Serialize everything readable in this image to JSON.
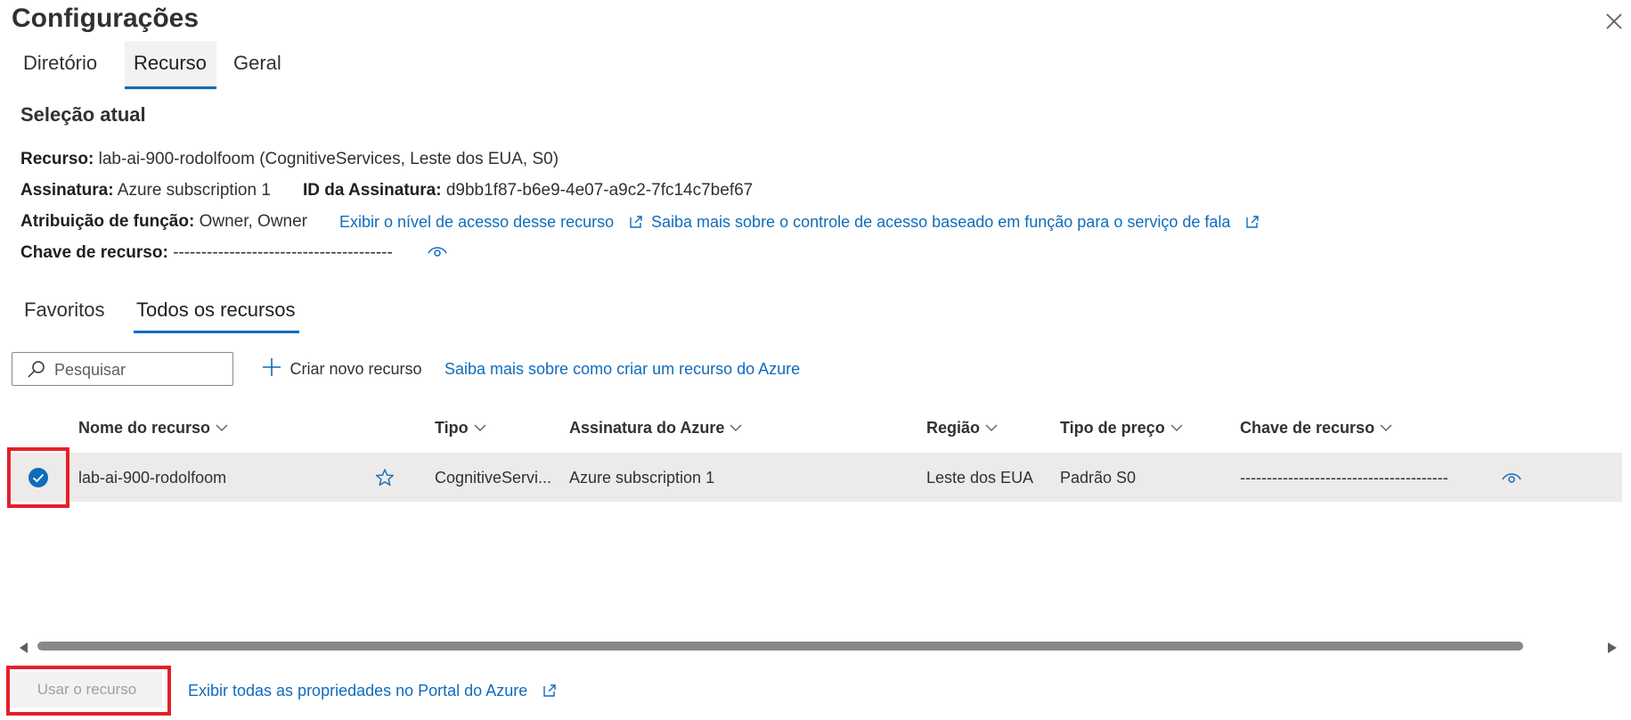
{
  "dialog": {
    "title": "Configurações",
    "close_icon": "close-icon"
  },
  "top_tabs": [
    {
      "label": "Diretório",
      "active": false
    },
    {
      "label": "Recurso",
      "active": true
    },
    {
      "label": "Geral",
      "active": false
    }
  ],
  "current_selection": {
    "title": "Seleção atual",
    "resource_label": "Recurso:",
    "resource_value": "lab-ai-900-rodolfoom (CognitiveServices, Leste dos EUA, S0)",
    "subscription_label": "Assinatura:",
    "subscription_value": "Azure subscription 1",
    "subscription_id_label": "ID da Assinatura:",
    "subscription_id_value": "d9bb1f87-b6e9-4e07-a9c2-7fc14c7bef67",
    "role_label": "Atribuição de função:",
    "role_value": "Owner, Owner",
    "access_link": "Exibir o nível de acesso desse recurso",
    "rbac_link": "Saiba mais sobre o controle de acesso baseado em função para o serviço de fala",
    "key_label": "Chave de recurso:",
    "key_value": "---------------------------------------"
  },
  "list_tabs": [
    {
      "label": "Favoritos",
      "active": false
    },
    {
      "label": "Todos os recursos",
      "active": true
    }
  ],
  "toolbar": {
    "search_placeholder": "Pesquisar",
    "create_label": "Criar novo recurso",
    "learn_link": "Saiba mais sobre como criar um recurso do Azure"
  },
  "table": {
    "columns": [
      "Nome do recurso",
      "Tipo",
      "Assinatura do Azure",
      "Região",
      "Tipo de preço",
      "Chave de recurso"
    ],
    "rows": [
      {
        "selected": true,
        "favorite": false,
        "name": "lab-ai-900-rodolfoom",
        "type": "CognitiveServi...",
        "subscription": "Azure subscription 1",
        "region": "Leste dos EUA",
        "pricing": "Padrão S0",
        "key": "---------------------------------------"
      }
    ]
  },
  "footer": {
    "use_button": "Usar o recurso",
    "portal_link": "Exibir todas as propriedades no Portal do Azure"
  },
  "colors": {
    "accent": "#0f6cbd",
    "highlight": "#e3202a",
    "row_selected": "#edebe9"
  }
}
